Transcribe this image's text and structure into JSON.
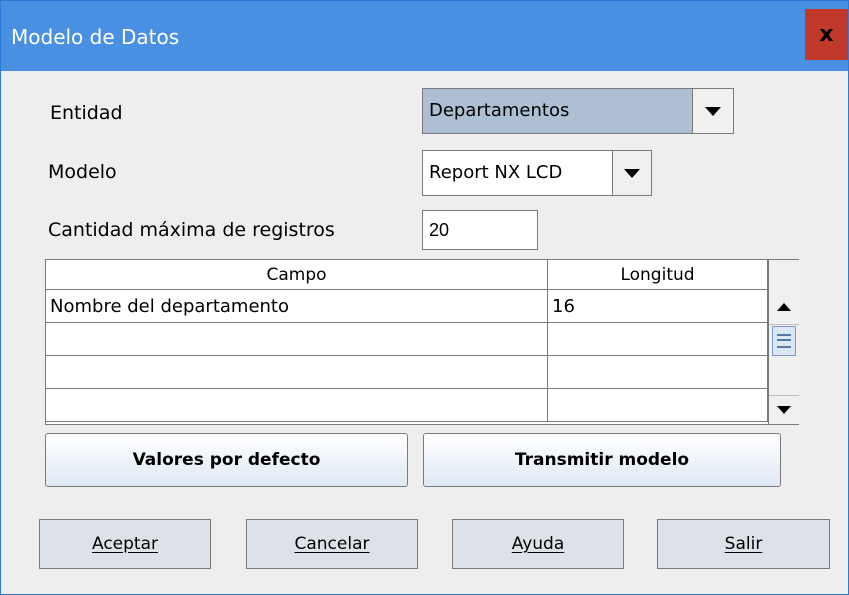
{
  "window": {
    "title": "Modelo de Datos",
    "close_label": "x"
  },
  "form": {
    "entidad_label": "Entidad",
    "entidad_value": "Departamentos",
    "modelo_label": "Modelo",
    "modelo_value": "Report NX LCD",
    "cantidad_label": "Cantidad máxima de registros",
    "cantidad_value": "20"
  },
  "table": {
    "headers": [
      "Campo",
      "Longitud"
    ],
    "rows": [
      [
        "Nombre del departamento",
        "16"
      ],
      [
        "",
        ""
      ],
      [
        "",
        ""
      ],
      [
        "",
        ""
      ]
    ]
  },
  "buttons": {
    "defaults": "Valores por defecto",
    "transmit": "Transmitir modelo",
    "accept": "Aceptar",
    "cancel": "Cancelar",
    "help": "Ayuda",
    "exit": "Salir"
  },
  "colors": {
    "titlebar": "#4a90e2",
    "close": "#c0392b",
    "selected_combo": "#aebfd4"
  }
}
